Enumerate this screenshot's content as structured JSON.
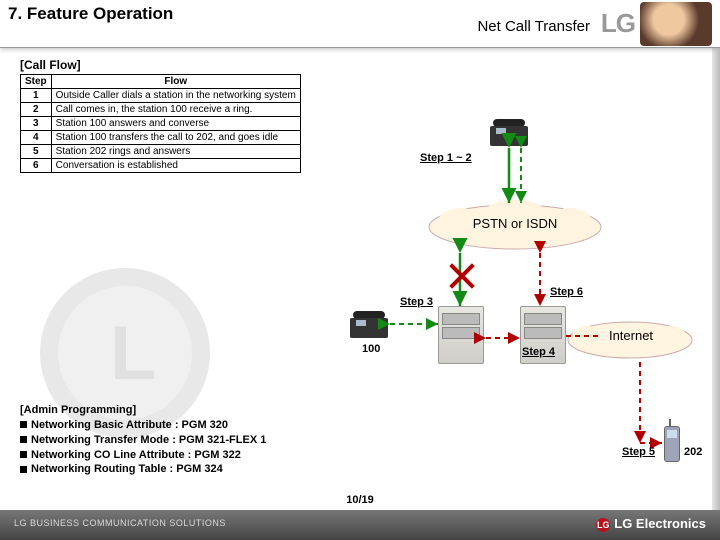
{
  "header": {
    "section_title": "7. Feature Operation",
    "feature_title": "Net Call Transfer",
    "logo_text": "LG"
  },
  "flow": {
    "title": "[Call Flow]",
    "columns": [
      "Step",
      "Flow"
    ],
    "rows": [
      {
        "step": "1",
        "desc": "Outside Caller dials a station in the networking system"
      },
      {
        "step": "2",
        "desc": "Call comes in, the station 100 receive a ring."
      },
      {
        "step": "3",
        "desc": "Station 100 answers and converse"
      },
      {
        "step": "4",
        "desc": "Station 100 transfers the call to 202, and goes idle"
      },
      {
        "step": "5",
        "desc": "Station 202 rings and answers"
      },
      {
        "step": "6",
        "desc": "Conversation is established"
      }
    ]
  },
  "diagram": {
    "step_labels": {
      "s12": "Step 1 ~ 2",
      "s3": "Step 3",
      "s4": "Step 4",
      "s5": "Step 5",
      "s6": "Step 6"
    },
    "clouds": {
      "pstn": "PSTN or ISDN",
      "internet": "Internet"
    },
    "nodes": {
      "station100": "100",
      "station202": "202"
    }
  },
  "admin": {
    "title": "[Admin Programming]",
    "items": [
      "Networking Basic Attribute : PGM 320",
      "Networking Transfer Mode : PGM 321-FLEX 1",
      "Networking CO Line Attribute : PGM 322",
      "Networking Routing Table : PGM 324"
    ]
  },
  "footer": {
    "left": "LG BUSINESS COMMUNICATION SOLUTIONS",
    "right": "LG Electronics",
    "page": "10/19"
  }
}
